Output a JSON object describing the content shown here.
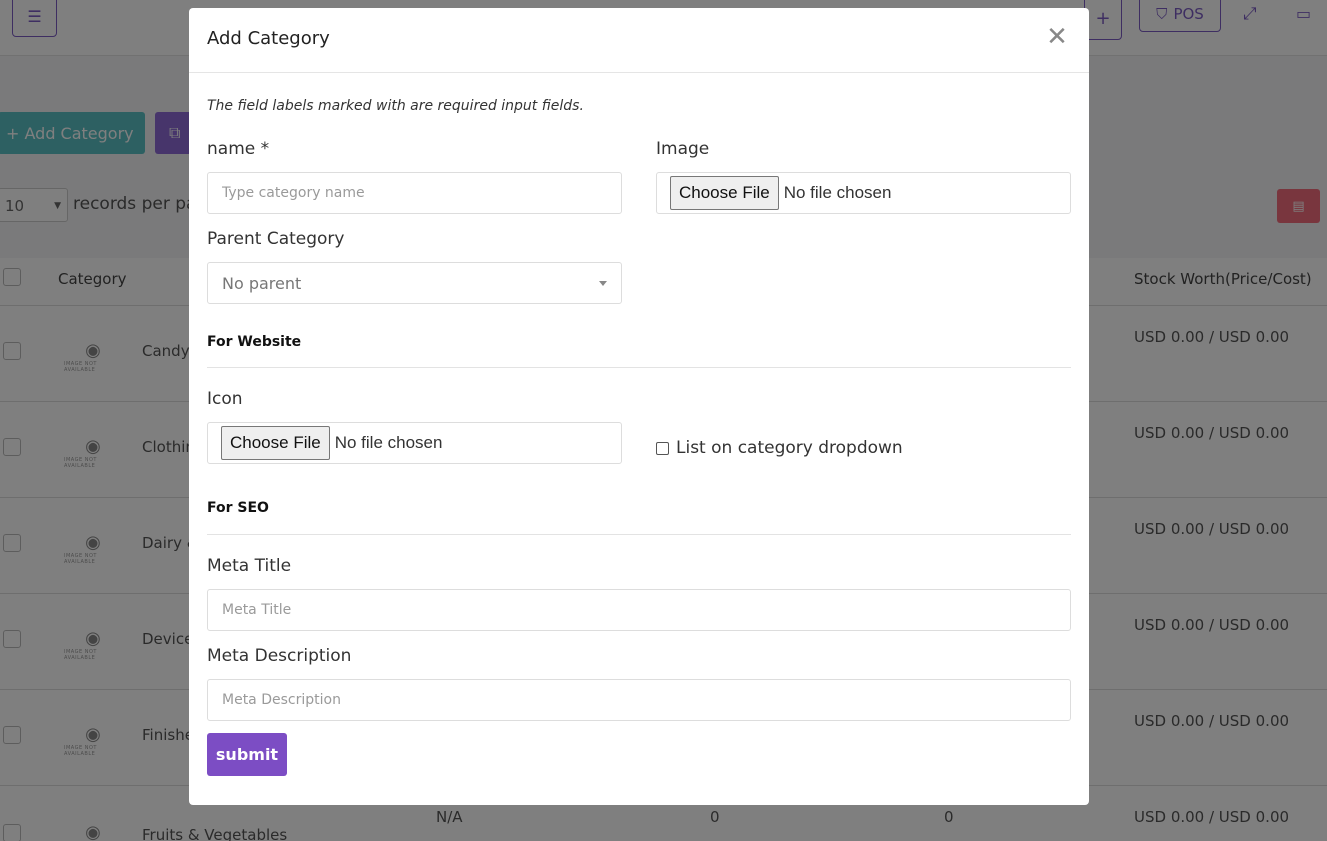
{
  "background": {
    "pos_label": "POS",
    "add_category_label": "+ Add Category",
    "per_page_value": "10",
    "records_text": "records per pa",
    "table": {
      "col_category": "Category",
      "col_stock": "Stock Worth(Price/Cost)",
      "rows": [
        {
          "name": "Candy",
          "stock": "USD 0.00 / USD 0.00"
        },
        {
          "name": "Clothin",
          "stock": "USD 0.00 / USD 0.00"
        },
        {
          "name": "Dairy &",
          "stock": "USD 0.00 / USD 0.00"
        },
        {
          "name": "Device",
          "stock": "USD 0.00 / USD 0.00"
        },
        {
          "name": "Finishe",
          "stock": "USD 0.00 / USD 0.00"
        },
        {
          "name": "Fruits & Vegetables",
          "stock": "USD 0.00 / USD 0.00",
          "parent": "N/A",
          "products": "0",
          "stock_qty": "0"
        }
      ]
    }
  },
  "modal": {
    "title": "Add Category",
    "note": "The field labels marked with are required input fields.",
    "name_label": "name *",
    "name_placeholder": "Type category name",
    "image_label": "Image",
    "file_button": "Choose File",
    "file_status": "No file chosen",
    "parent_label": "Parent Category",
    "parent_value": "No parent",
    "section_website": "For Website",
    "icon_label": "Icon",
    "dropdown_check_label": "List on category dropdown",
    "section_seo": "For SEO",
    "meta_title_label": "Meta Title",
    "meta_title_placeholder": "Meta Title",
    "meta_desc_label": "Meta Description",
    "meta_desc_placeholder": "Meta Description",
    "submit_label": "submit"
  },
  "colors": {
    "accent": "#7c4dc4",
    "teal": "#5bc0c4",
    "danger": "#f26d7d"
  }
}
